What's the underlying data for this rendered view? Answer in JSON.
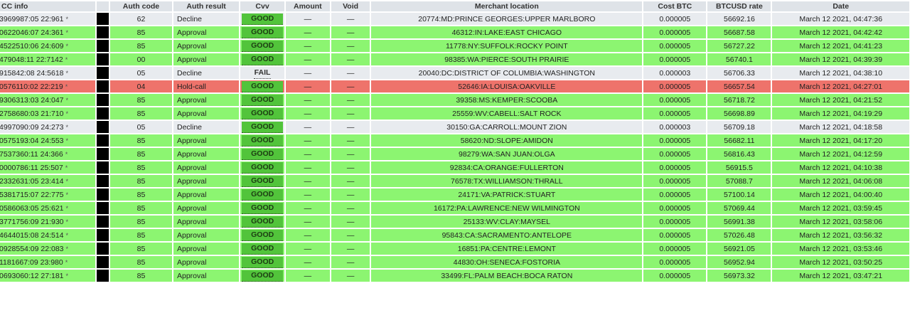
{
  "headers": {
    "cc_info": "CC info",
    "mask": "",
    "auth_code": "Auth code",
    "auth_result": "Auth result",
    "cvv": "Cvv",
    "amount": "Amount",
    "void": "Void",
    "merchant_location": "Merchant location",
    "cost_btc": "Cost BTC",
    "btcusd_rate": "BTCUSD rate",
    "date": "Date"
  },
  "status_colors": {
    "approval": "#8cf571",
    "decline": "#e8ebef",
    "holdcall": "#ee736b",
    "good_badge": "#52c43b"
  },
  "rows": [
    {
      "status": "decline",
      "cc": "3969987:05 22:961",
      "star": "*",
      "auth": "62",
      "result": "Decline",
      "cvv": "GOOD",
      "cvv_type": "good",
      "amount": "—",
      "void": "—",
      "location": "20774:MD:PRINCE GEORGES:UPPER MARLBORO",
      "cost": "0.000005",
      "rate": "56692.16",
      "date": "March 12 2021, 04:47:36"
    },
    {
      "status": "approval",
      "cc": "0622046:07 24:361",
      "star": "*",
      "auth": "85",
      "result": "Approval",
      "cvv": "GOOD",
      "cvv_type": "good",
      "amount": "—",
      "void": "—",
      "location": "46312:IN:LAKE:EAST CHICAGO",
      "cost": "0.000005",
      "rate": "56687.58",
      "date": "March 12 2021, 04:42:42"
    },
    {
      "status": "approval",
      "cc": "4522510:06 24:609",
      "star": "*",
      "auth": "85",
      "result": "Approval",
      "cvv": "GOOD",
      "cvv_type": "good",
      "amount": "—",
      "void": "—",
      "location": "11778:NY:SUFFOLK:ROCKY POINT",
      "cost": "0.000005",
      "rate": "56727.22",
      "date": "March 12 2021, 04:41:23"
    },
    {
      "status": "approval",
      "cc": "479048:11 22:7142",
      "star": "*",
      "auth": "00",
      "result": "Approval",
      "cvv": "GOOD",
      "cvv_type": "good",
      "amount": "—",
      "void": "—",
      "location": "98385:WA:PIERCE:SOUTH PRAIRIE",
      "cost": "0.000005",
      "rate": "56740.1",
      "date": "March 12 2021, 04:39:39"
    },
    {
      "status": "decline",
      "cc": "915842:08 24:5618",
      "star": "*",
      "auth": "05",
      "result": "Decline",
      "cvv": "FAIL",
      "cvv_type": "fail",
      "amount": "—",
      "void": "—",
      "location": "20040:DC:DISTRICT OF COLUMBIA:WASHINGTON",
      "cost": "0.000003",
      "rate": "56706.33",
      "date": "March 12 2021, 04:38:10"
    },
    {
      "status": "holdcall",
      "cc": "0576110:02 22:219",
      "star": "*",
      "auth": "04",
      "result": "Hold-call",
      "cvv": "GOOD",
      "cvv_type": "good",
      "amount": "—",
      "void": "—",
      "location": "52646:IA:LOUISA:OAKVILLE",
      "cost": "0.000005",
      "rate": "56657.54",
      "date": "March 12 2021, 04:27:01"
    },
    {
      "status": "approval",
      "cc": "9306313:03 24:047",
      "star": "*",
      "auth": "85",
      "result": "Approval",
      "cvv": "GOOD",
      "cvv_type": "good",
      "amount": "—",
      "void": "—",
      "location": "39358:MS:KEMPER:SCOOBA",
      "cost": "0.000005",
      "rate": "56718.72",
      "date": "March 12 2021, 04:21:52"
    },
    {
      "status": "approval",
      "cc": "2758680:03 21:710",
      "star": "*",
      "auth": "85",
      "result": "Approval",
      "cvv": "GOOD",
      "cvv_type": "good",
      "amount": "—",
      "void": "—",
      "location": "25559:WV:CABELL:SALT ROCK",
      "cost": "0.000005",
      "rate": "56698.89",
      "date": "March 12 2021, 04:19:29"
    },
    {
      "status": "decline",
      "cc": "4997090:09 24:273",
      "star": "*",
      "auth": "05",
      "result": "Decline",
      "cvv": "GOOD",
      "cvv_type": "good",
      "amount": "—",
      "void": "—",
      "location": "30150:GA:CARROLL:MOUNT ZION",
      "cost": "0.000003",
      "rate": "56709.18",
      "date": "March 12 2021, 04:18:58"
    },
    {
      "status": "approval",
      "cc": "0575193:04 24:553",
      "star": "*",
      "auth": "85",
      "result": "Approval",
      "cvv": "GOOD",
      "cvv_type": "good",
      "amount": "—",
      "void": "—",
      "location": "58620:ND:SLOPE:AMIDON",
      "cost": "0.000005",
      "rate": "56682.11",
      "date": "March 12 2021, 04:17:20"
    },
    {
      "status": "approval",
      "cc": "7537360:11 24:366",
      "star": "*",
      "auth": "85",
      "result": "Approval",
      "cvv": "GOOD",
      "cvv_type": "good",
      "amount": "—",
      "void": "—",
      "location": "98279:WA:SAN JUAN:OLGA",
      "cost": "0.000005",
      "rate": "56816.43",
      "date": "March 12 2021, 04:12:59"
    },
    {
      "status": "approval",
      "cc": "0000786:11 25:507",
      "star": "*",
      "auth": "85",
      "result": "Approval",
      "cvv": "GOOD",
      "cvv_type": "good",
      "amount": "—",
      "void": "—",
      "location": "92834:CA:ORANGE:FULLERTON",
      "cost": "0.000005",
      "rate": "56915.5",
      "date": "March 12 2021, 04:10:38"
    },
    {
      "status": "approval",
      "cc": "2332631:05 23:414",
      "star": "*",
      "auth": "85",
      "result": "Approval",
      "cvv": "GOOD",
      "cvv_type": "good",
      "amount": "—",
      "void": "—",
      "location": "76578:TX:WILLIAMSON:THRALL",
      "cost": "0.000005",
      "rate": "57088.7",
      "date": "March 12 2021, 04:06:08"
    },
    {
      "status": "approval",
      "cc": "5381715:07 22:775",
      "star": "*",
      "auth": "85",
      "result": "Approval",
      "cvv": "GOOD",
      "cvv_type": "good",
      "amount": "—",
      "void": "—",
      "location": "24171:VA:PATRICK:STUART",
      "cost": "0.000005",
      "rate": "57100.14",
      "date": "March 12 2021, 04:00:40"
    },
    {
      "status": "approval",
      "cc": "0586063:05 25:621",
      "star": "*",
      "auth": "85",
      "result": "Approval",
      "cvv": "GOOD",
      "cvv_type": "good",
      "amount": "—",
      "void": "—",
      "location": "16172:PA:LAWRENCE:NEW WILMINGTON",
      "cost": "0.000005",
      "rate": "57069.44",
      "date": "March 12 2021, 03:59:45"
    },
    {
      "status": "approval",
      "cc": "3771756:09 21:930",
      "star": "*",
      "auth": "85",
      "result": "Approval",
      "cvv": "GOOD",
      "cvv_type": "good",
      "amount": "—",
      "void": "—",
      "location": "25133:WV:CLAY:MAYSEL",
      "cost": "0.000005",
      "rate": "56991.38",
      "date": "March 12 2021, 03:58:06"
    },
    {
      "status": "approval",
      "cc": "4644015:08 24:514",
      "star": "*",
      "auth": "85",
      "result": "Approval",
      "cvv": "GOOD",
      "cvv_type": "good",
      "amount": "—",
      "void": "—",
      "location": "95843:CA:SACRAMENTO:ANTELOPE",
      "cost": "0.000005",
      "rate": "57026.48",
      "date": "March 12 2021, 03:56:32"
    },
    {
      "status": "approval",
      "cc": "0928554:09 22:083",
      "star": "*",
      "auth": "85",
      "result": "Approval",
      "cvv": "GOOD",
      "cvv_type": "good",
      "amount": "—",
      "void": "—",
      "location": "16851:PA:CENTRE:LEMONT",
      "cost": "0.000005",
      "rate": "56921.05",
      "date": "March 12 2021, 03:53:46"
    },
    {
      "status": "approval",
      "cc": "1181667:09 23:980",
      "star": "*",
      "auth": "85",
      "result": "Approval",
      "cvv": "GOOD",
      "cvv_type": "good",
      "amount": "—",
      "void": "—",
      "location": "44830:OH:SENECA:FOSTORIA",
      "cost": "0.000005",
      "rate": "56952.94",
      "date": "March 12 2021, 03:50:25"
    },
    {
      "status": "approval",
      "cc": "0693060:12 27:181",
      "star": "*",
      "auth": "85",
      "result": "Approval",
      "cvv": "GOOD",
      "cvv_type": "good",
      "amount": "—",
      "void": "—",
      "location": "33499:FL:PALM BEACH:BOCA RATON",
      "cost": "0.000005",
      "rate": "56973.32",
      "date": "March 12 2021, 03:47:21"
    }
  ]
}
